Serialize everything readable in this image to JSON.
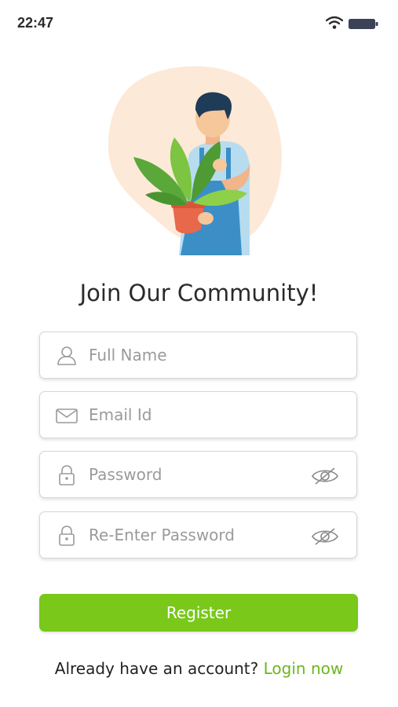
{
  "status_bar": {
    "time": "22:47",
    "icons": [
      "wifi-icon",
      "battery-icon"
    ]
  },
  "illustration": {
    "subject": "person-holding-potted-plant"
  },
  "title": "Join Our Community!",
  "form": {
    "full_name": {
      "placeholder": "Full Name",
      "value": "",
      "icon": "user-icon"
    },
    "email": {
      "placeholder": "Email Id",
      "value": "",
      "icon": "mail-icon"
    },
    "password": {
      "placeholder": "Password",
      "value": "",
      "icon": "lock-icon",
      "toggle_icon": "eye-slash-icon"
    },
    "confirm_password": {
      "placeholder": "Re-Enter Password",
      "value": "",
      "icon": "lock-icon",
      "toggle_icon": "eye-slash-icon"
    }
  },
  "register_label": "Register",
  "footer": {
    "prompt": "Already have an account? ",
    "link": "Login now"
  },
  "colors": {
    "accent": "#79c81a",
    "link": "#6db61f",
    "blob": "#fde9d7"
  }
}
